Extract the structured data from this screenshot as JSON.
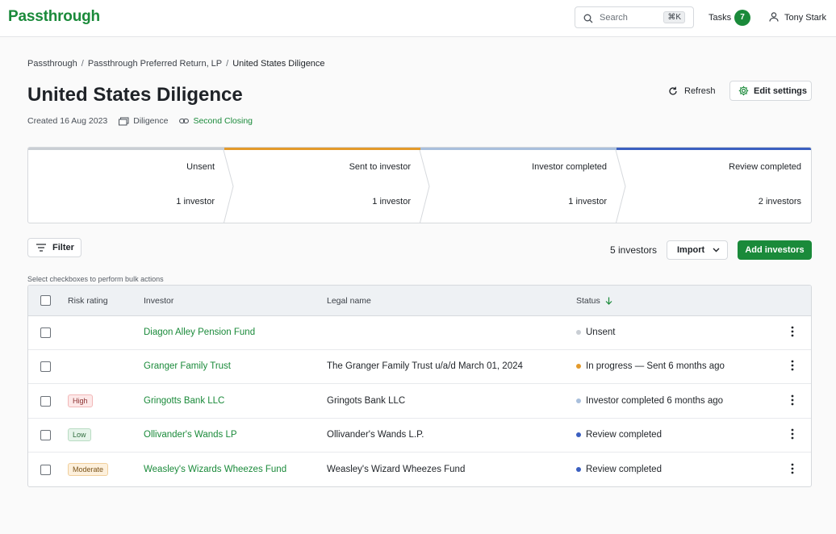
{
  "app": {
    "logo": "Passthrough"
  },
  "header": {
    "search_placeholder": "Search",
    "search_shortcut": "⌘K",
    "tasks_label": "Tasks",
    "tasks_count": "7",
    "user_name": "Tony Stark"
  },
  "breadcrumb": [
    "Passthrough",
    "Passthrough Preferred Return, LP",
    "United States Diligence"
  ],
  "page": {
    "title": "United States Diligence",
    "created": "Created 16 Aug 2023",
    "type": "Diligence",
    "closing": "Second Closing",
    "refresh_label": "Refresh",
    "edit_label": "Edit settings"
  },
  "pipeline": [
    {
      "label": "Unsent",
      "count": "1 investor",
      "color": "#c9ced4"
    },
    {
      "label": "Sent to investor",
      "count": "1 investor",
      "color": "#e39a2b"
    },
    {
      "label": "Investor completed",
      "count": "1 investor",
      "color": "#a9bfdc"
    },
    {
      "label": "Review completed",
      "count": "2 investors",
      "color": "#3b5fc0"
    }
  ],
  "toolbar": {
    "filter_label": "Filter",
    "count": "5 investors",
    "import_label": "Import",
    "add_label": "Add investors",
    "hint": "Select checkboxes to perform bulk actions"
  },
  "table": {
    "columns": {
      "risk": "Risk rating",
      "investor": "Investor",
      "legal": "Legal name",
      "status": "Status"
    },
    "rows": [
      {
        "risk": "",
        "risk_level": "",
        "investor": "Diagon Alley Pension Fund",
        "legal": "",
        "status": "Unsent",
        "status_color": "#c9ced4"
      },
      {
        "risk": "",
        "risk_level": "",
        "investor": "Granger Family Trust",
        "legal": "The Granger Family Trust u/a/d March 01, 2024",
        "status": "In progress — Sent 6 months ago",
        "status_color": "#e39a2b"
      },
      {
        "risk": "High",
        "risk_level": "high",
        "investor": "Gringotts Bank LLC",
        "legal": "Gringots Bank LLC",
        "status": "Investor completed 6 months ago",
        "status_color": "#a9bfdc"
      },
      {
        "risk": "Low",
        "risk_level": "low",
        "investor": "Ollivander's Wands LP",
        "legal": "Ollivander's Wands L.P.",
        "status": "Review completed",
        "status_color": "#3b5fc0"
      },
      {
        "risk": "Moderate",
        "risk_level": "moderate",
        "investor": "Weasley's Wizards Wheezes Fund",
        "legal": "Weasley's Wizard Wheezes Fund",
        "status": "Review completed",
        "status_color": "#3b5fc0"
      }
    ]
  }
}
